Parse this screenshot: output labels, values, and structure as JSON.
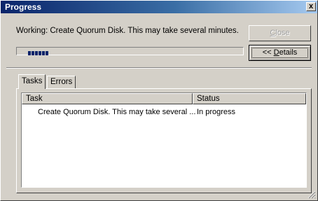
{
  "window": {
    "title": "Progress",
    "close_glyph": "x"
  },
  "status_message": "Working: Create Quorum Disk. This may take several minutes.",
  "buttons": {
    "close": {
      "label_underlined": "C",
      "label_rest": "lose",
      "enabled": false
    },
    "details": {
      "label_prefix": "<< ",
      "label_underlined": "D",
      "label_rest": "etails"
    }
  },
  "progress": {
    "value_percent": 10
  },
  "tabs": [
    {
      "label": "Tasks",
      "selected": true
    },
    {
      "label": "Errors",
      "selected": false
    }
  ],
  "tasks_table": {
    "columns": [
      "Task",
      "Status"
    ],
    "rows": [
      {
        "task": "Create Quorum Disk. This may take several ...",
        "status": "In progress"
      }
    ]
  },
  "colors": {
    "title_gradient_start": "#0a246a",
    "title_gradient_end": "#a6caf0",
    "dialog_face": "#d4d0c8",
    "progress_block": "#0a246a"
  },
  "icons": {
    "close": "close-icon",
    "resize": "resize-grip-icon"
  }
}
